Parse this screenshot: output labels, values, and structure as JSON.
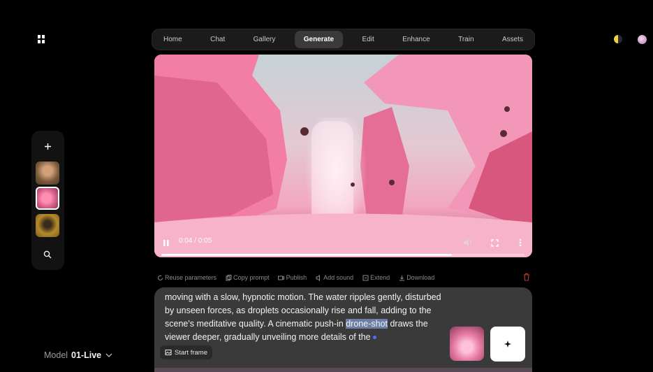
{
  "nav": {
    "tabs": [
      {
        "label": "Home"
      },
      {
        "label": "Chat"
      },
      {
        "label": "Gallery"
      },
      {
        "label": "Generate"
      },
      {
        "label": "Edit"
      },
      {
        "label": "Enhance"
      },
      {
        "label": "Train"
      },
      {
        "label": "Assets"
      }
    ],
    "active_tab": "Generate"
  },
  "sidebar": {
    "icons": [
      "plus-icon",
      "search-icon"
    ],
    "history_thumbnails": 3,
    "selected_index": 1
  },
  "video": {
    "time": "0:04 / 0:05",
    "progress_fraction": 0.8,
    "controls": [
      "pause-icon",
      "volume-icon",
      "fullscreen-icon",
      "more-icon"
    ]
  },
  "actions": [
    {
      "label": "Reuse parameters",
      "icon": "reuse-icon"
    },
    {
      "label": "Copy prompt",
      "icon": "copy-icon"
    },
    {
      "label": "Publish",
      "icon": "publish-icon"
    },
    {
      "label": "Add sound",
      "icon": "sound-icon"
    },
    {
      "label": "Extend",
      "icon": "extend-icon"
    },
    {
      "label": "Download",
      "icon": "download-icon"
    }
  ],
  "prompt": {
    "before_highlight": "moving with a slow, hypnotic motion. The water ripples gently, disturbed by unseen forces, as droplets occasionally rise and fall, adding to the scene's meditative quality. A cinematic push-in ",
    "highlight": "drone-shot",
    "after_highlight": " draws the viewer deeper, gradually unveiling more details of the",
    "start_frame_label": "Start frame"
  },
  "model": {
    "label": "Model",
    "value": "01-Live"
  },
  "colors": {
    "highlight": "#6a7ea8",
    "cursor": "#5b66ff",
    "accent_pink": "#e57aa3"
  }
}
